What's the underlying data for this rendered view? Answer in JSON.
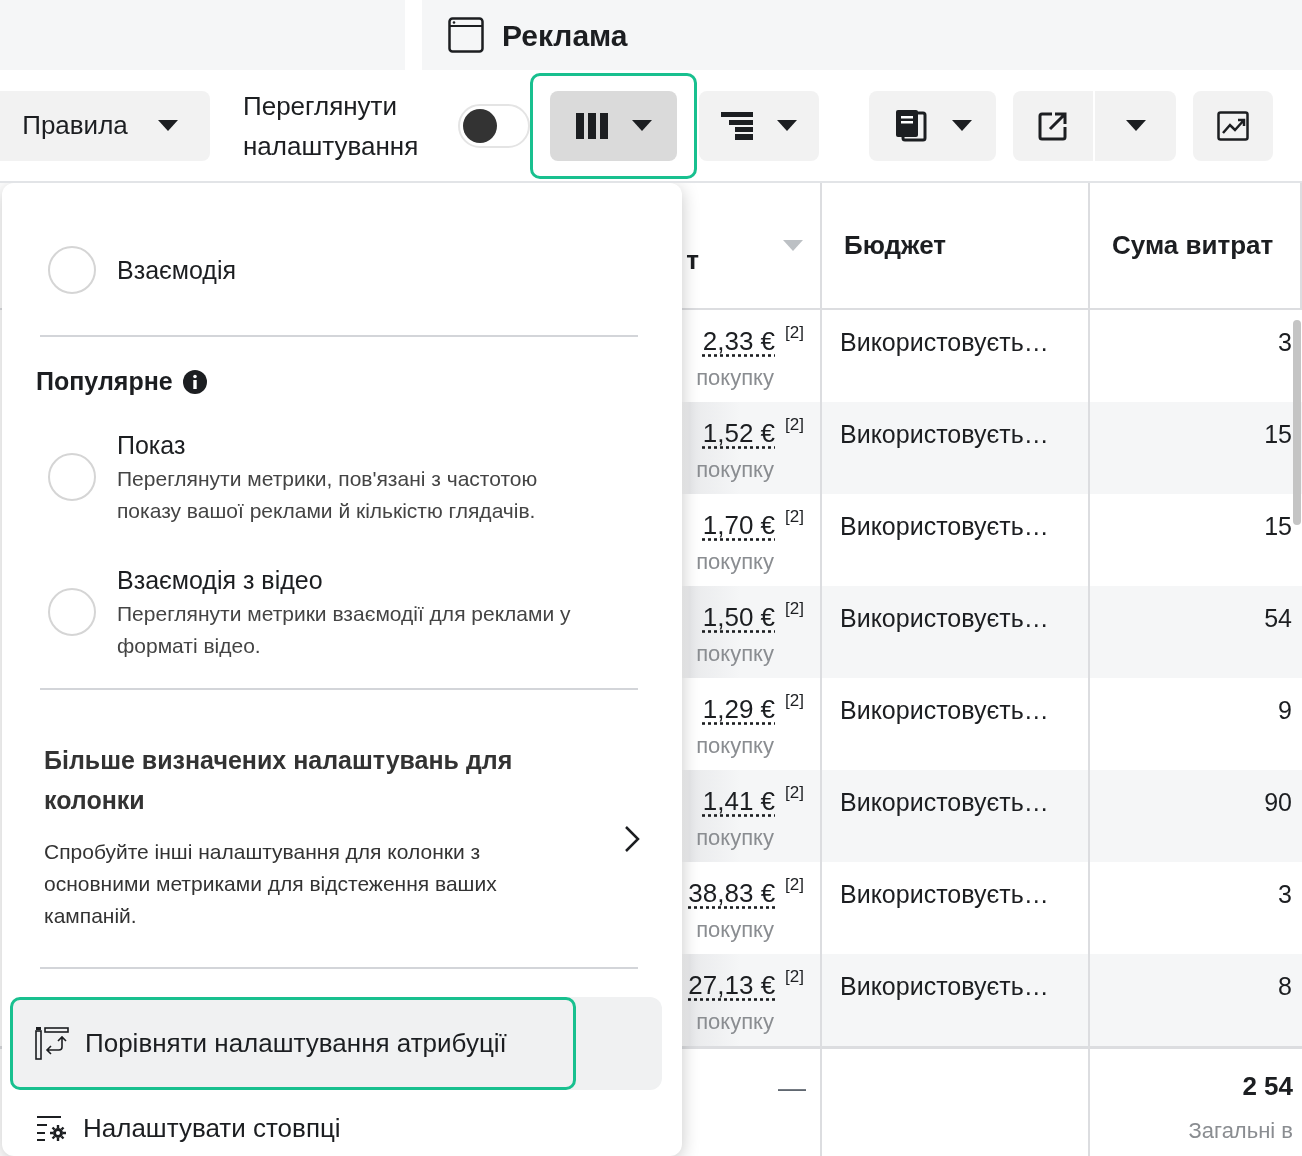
{
  "header": {
    "title": "Реклама"
  },
  "toolbar": {
    "rules_button": "Правила",
    "view_settings": {
      "label": "Переглянути налаштування",
      "on": false
    },
    "buttons": [
      {
        "kind": "columns",
        "caret": true,
        "active": true,
        "highlighted": true
      },
      {
        "kind": "breakdown",
        "caret": true,
        "active": false,
        "highlighted": false
      },
      {
        "kind": "reports",
        "caret": true,
        "active": false,
        "highlighted": false
      },
      {
        "kind": "export",
        "caret": false,
        "active": false,
        "highlighted": false
      },
      {
        "kind": "export-menu",
        "caret": true,
        "active": false,
        "highlighted": false
      },
      {
        "kind": "chart",
        "caret": false,
        "active": false,
        "highlighted": false
      }
    ]
  },
  "table": {
    "columns": [
      {
        "label": "т",
        "sorted": true
      },
      {
        "label": "Бюджет",
        "sorted": false
      },
      {
        "label": "Сума витрат",
        "sorted": false
      }
    ],
    "rows": [
      {
        "cost": "2,33 €",
        "note": "[2]",
        "sub": "покупку",
        "budget": "Використовуєть…",
        "spend": "3"
      },
      {
        "cost": "1,52 €",
        "note": "[2]",
        "sub": "покупку",
        "budget": "Використовуєть…",
        "spend": "15"
      },
      {
        "cost": "1,70 €",
        "note": "[2]",
        "sub": "покупку",
        "budget": "Використовуєть…",
        "spend": "15"
      },
      {
        "cost": "1,50 €",
        "note": "[2]",
        "sub": "покупку",
        "budget": "Використовуєть…",
        "spend": "54"
      },
      {
        "cost": "1,29 €",
        "note": "[2]",
        "sub": "покупку",
        "budget": "Використовуєть…",
        "spend": "9"
      },
      {
        "cost": "1,41 €",
        "note": "[2]",
        "sub": "покупку",
        "budget": "Використовуєть…",
        "spend": "90"
      },
      {
        "cost": "38,83 €",
        "note": "[2]",
        "sub": "покупку",
        "budget": "Використовуєть…",
        "spend": "3"
      },
      {
        "cost": "27,13 €",
        "note": "[2]",
        "sub": "покупку",
        "budget": "Використовуєть…",
        "spend": "8"
      }
    ],
    "summary": {
      "cost": "—",
      "spend": "2 54",
      "spend_label": "Загальні в"
    }
  },
  "menu": {
    "items": [
      {
        "kind": "radio",
        "label": "Взаємодія",
        "selected": false
      },
      {
        "kind": "divider"
      },
      {
        "kind": "heading",
        "label": "Популярне",
        "info": true
      },
      {
        "kind": "radio",
        "label": "Показ",
        "description": "Переглянути метрики, пов'язані з частотою показу вашої реклами й кількістю глядачів.",
        "selected": false
      },
      {
        "kind": "radio",
        "label": "Взаємодія з відео",
        "description": "Переглянути метрики взаємодії для реклами у форматі відео.",
        "selected": false
      },
      {
        "kind": "divider"
      },
      {
        "kind": "card",
        "title": "Більше визначених налаштувань для колонки",
        "description": "Спробуйте інші налаштування для колонки з основними метриками для відстеження ваших кампаній."
      },
      {
        "kind": "divider"
      },
      {
        "kind": "compare",
        "label": "Порівняти налаштування атрибуції",
        "hovered": true,
        "highlighted": true
      },
      {
        "kind": "customize",
        "label": "Налаштувати стовпці",
        "hovered": false,
        "highlighted": false
      }
    ]
  }
}
